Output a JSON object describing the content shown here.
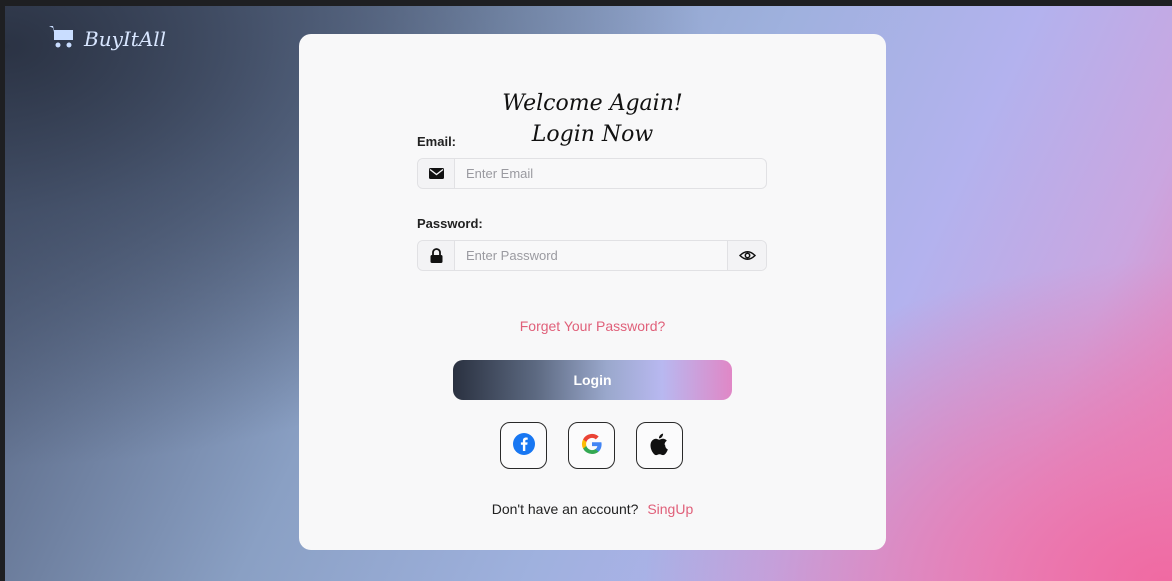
{
  "brand": {
    "name": "BuyItAll",
    "icon": "cart-icon"
  },
  "card": {
    "title_line1": "Welcome Again!",
    "title_line2": "Login Now",
    "email": {
      "label": "Email:",
      "placeholder": "Enter Email",
      "value": "",
      "icon": "envelope-icon"
    },
    "password": {
      "label": "Password:",
      "placeholder": "Enter Password",
      "value": "",
      "icon": "lock-icon",
      "toggle_icon": "eye-icon"
    },
    "forgot_link": "Forget Your Password?",
    "login_button": "Login",
    "social": [
      {
        "name": "facebook",
        "icon": "facebook-icon"
      },
      {
        "name": "google",
        "icon": "google-icon"
      },
      {
        "name": "apple",
        "icon": "apple-icon"
      }
    ],
    "signup_prompt": "Don't have an account?",
    "signup_link": "SingUp"
  },
  "colors": {
    "accent": "#e0607a",
    "card": "#f8f8f9",
    "facebook": "#1877f2"
  }
}
